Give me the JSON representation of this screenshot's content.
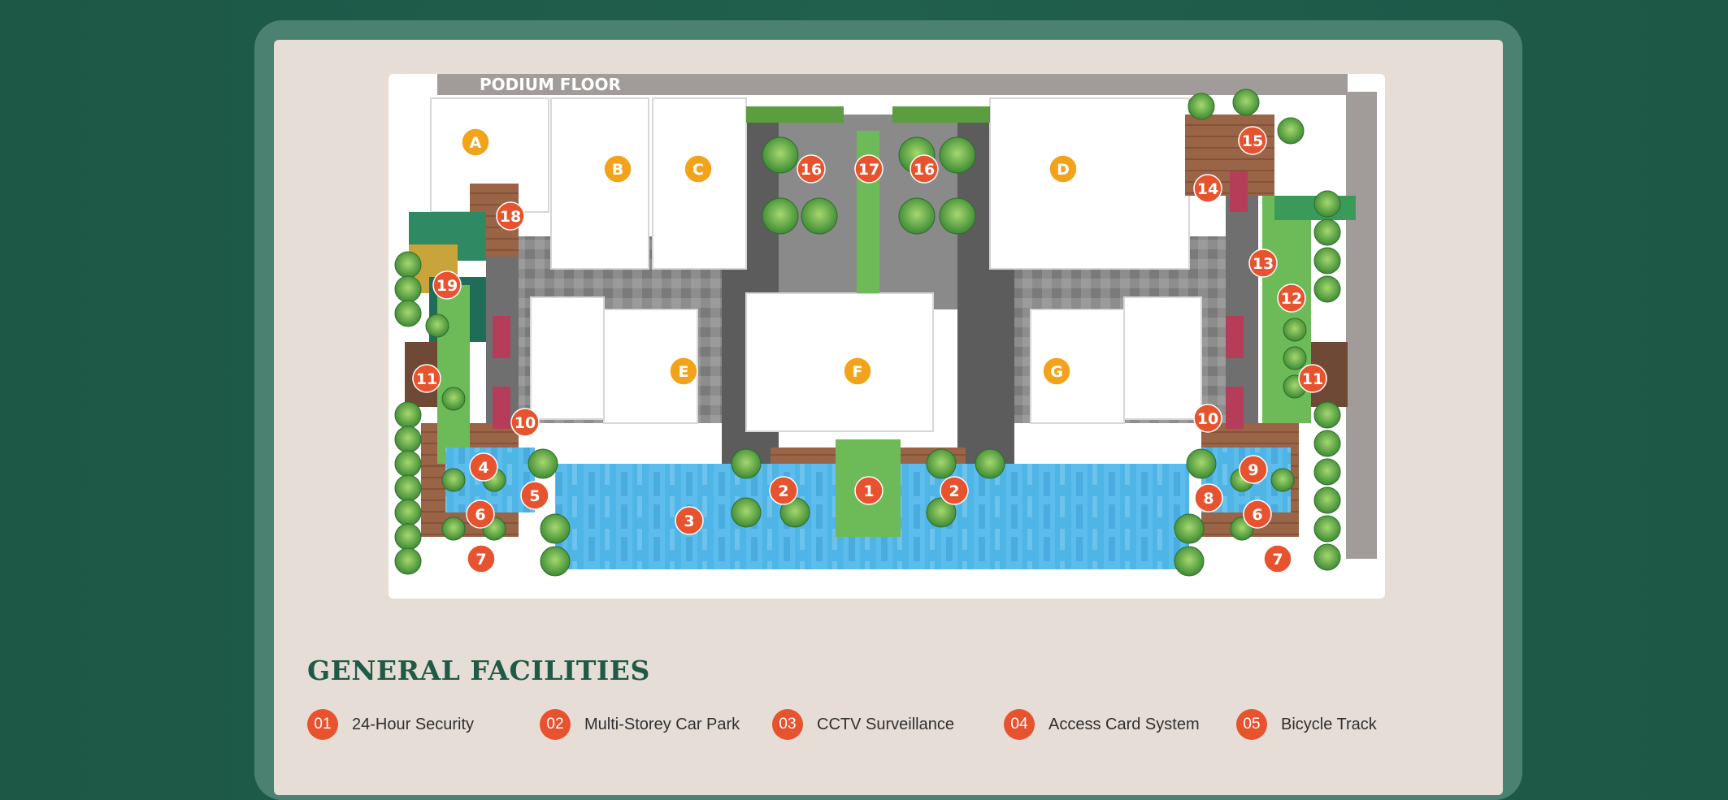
{
  "plan": {
    "title": "PODIUM FLOOR",
    "block_labels": [
      "A",
      "B",
      "C",
      "D",
      "E",
      "F",
      "G"
    ],
    "facility_markers": [
      "1",
      "2",
      "2",
      "3",
      "4",
      "5",
      "6",
      "6",
      "7",
      "7",
      "8",
      "9",
      "10",
      "10",
      "11",
      "11",
      "12",
      "13",
      "14",
      "15",
      "16",
      "16",
      "17",
      "18",
      "19"
    ],
    "colors": {
      "block_marker": "#f2a31b",
      "facility_marker": "#e8532f",
      "pool": "#4fb4e6",
      "lawn": "#6dbb58",
      "deck": "#9a6447",
      "road": "#5c5c5c",
      "tree": "#5aa84a"
    }
  },
  "section": {
    "title": "GENERAL FACILITIES"
  },
  "facilities": [
    {
      "num": "01",
      "label": "24-Hour Security"
    },
    {
      "num": "02",
      "label": "Multi-Storey Car Park"
    },
    {
      "num": "03",
      "label": "CCTV Surveillance"
    },
    {
      "num": "04",
      "label": "Access Card System"
    },
    {
      "num": "05",
      "label": "Bicycle Track"
    }
  ]
}
